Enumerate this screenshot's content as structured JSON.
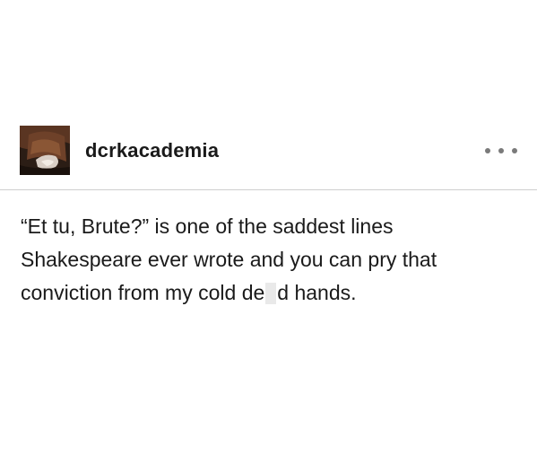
{
  "post": {
    "username": "dcrkacademia",
    "avatar_icon": "avatar-photo",
    "more_icon": "ellipsis-icon",
    "body": {
      "line1": "“Et tu, Brute?” is one of the saddest lines",
      "line2": "Shakespeare ever wrote and you can pry that",
      "line3_before": "conviction from my cold de",
      "line3_after": "d hands."
    }
  },
  "colors": {
    "background": "#ffffff",
    "text": "#1a1a1a",
    "divider": "#cfcfcf",
    "dots": "#7a7a7a"
  }
}
